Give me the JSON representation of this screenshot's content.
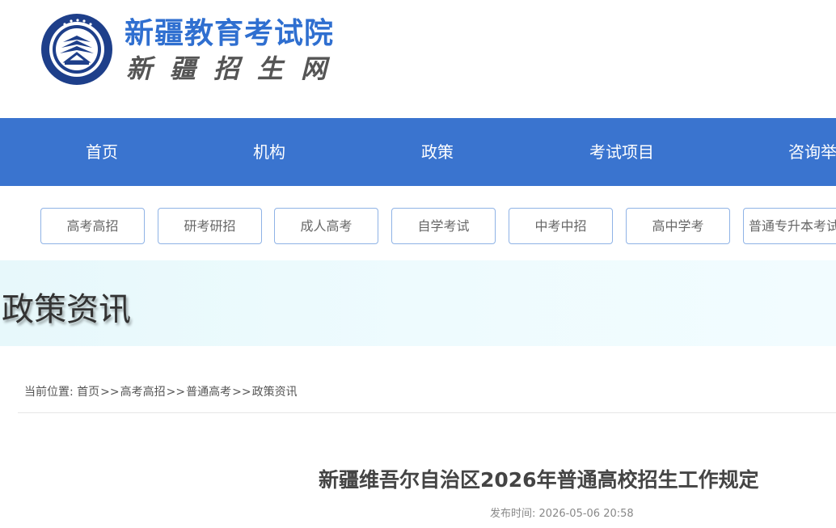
{
  "header": {
    "title": "新疆教育考试院",
    "subtitle": "新疆招生网",
    "logo_ring_text": "新疆教育考试院"
  },
  "mainnav": {
    "items": [
      {
        "label": "首页"
      },
      {
        "label": "机构"
      },
      {
        "label": "政策"
      },
      {
        "label": "考试项目"
      },
      {
        "label": "咨询举"
      }
    ]
  },
  "categories": [
    {
      "label": "高考高招"
    },
    {
      "label": "研考研招"
    },
    {
      "label": "成人高考"
    },
    {
      "label": "自学考试"
    },
    {
      "label": "中考中招"
    },
    {
      "label": "高中学考"
    },
    {
      "label": "普通专升本考试"
    }
  ],
  "banner": {
    "title": "政策资讯"
  },
  "breadcrumb": {
    "prefix": "当前位置:",
    "items": [
      "首页",
      "高考高招",
      "普通高考",
      "政策资讯"
    ],
    "separator": ">>"
  },
  "article": {
    "title": "新疆维吾尔自治区2026年普通高校招生工作规定",
    "publish_label": "发布时间:",
    "publish_time": "2026-05-06 20:58"
  },
  "colors": {
    "nav_bg": "#3a74cf",
    "brand_blue": "#2f6fd0",
    "emblem_navy": "#1e3f8a"
  },
  "icons": {
    "logo": "exam-institute-emblem-icon"
  }
}
